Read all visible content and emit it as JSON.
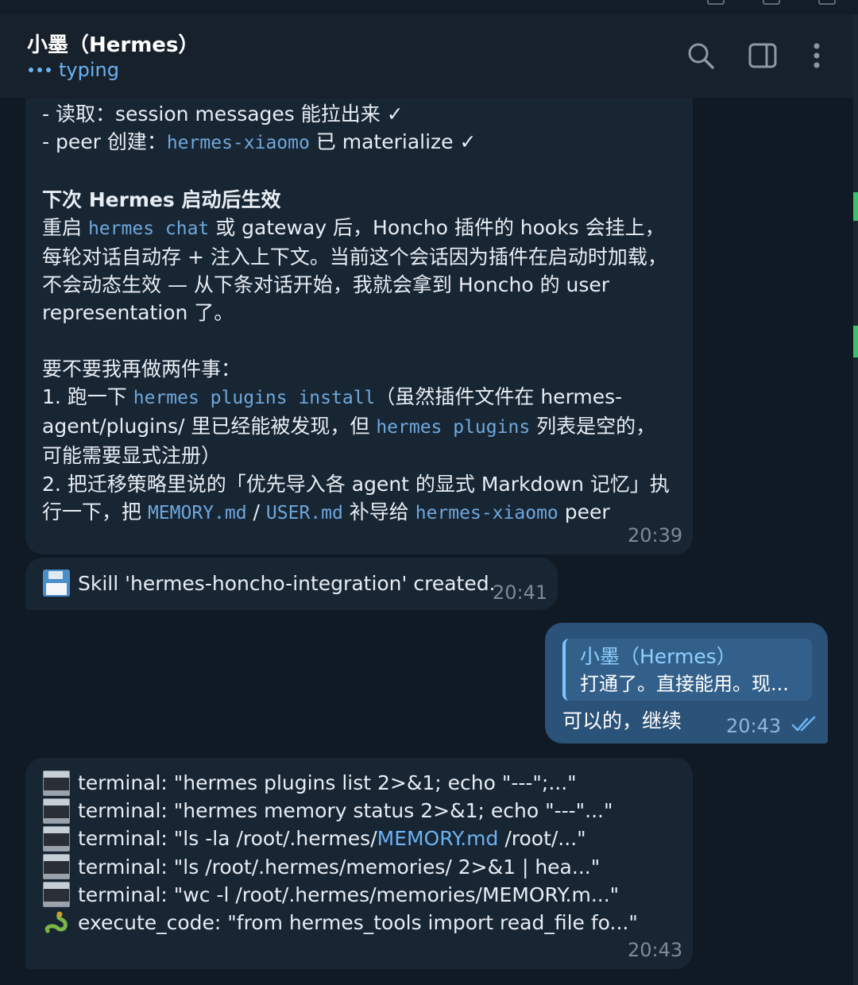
{
  "header": {
    "title": "小墨（Hermes）",
    "status": "typing"
  },
  "message1": {
    "lines": {
      "l1": {
        "a": "- 读取：session messages 能拉出来 ✓"
      },
      "l2": {
        "a": "- peer 创建：",
        "b": "hermes-xiaomo",
        "c": " 已 materialize ✓"
      },
      "heading": "下次 Hermes 启动后生效",
      "l4": {
        "a": "重启 ",
        "b": "hermes chat",
        "c": " 或 gateway 后，Honcho 插件的 hooks 会挂上，"
      },
      "l5": "每轮对话自动存 + 注入上下文。当前这个会话因为插件在启动时加载，",
      "l6": "不会动态生效 — 从下条对话开始，我就会拿到 Honcho 的 user",
      "l7": "representation 了。",
      "l8": "要不要我再做两件事：",
      "l9": {
        "a": "1. 跑一下 ",
        "b": "hermes plugins install",
        "c": "（虽然插件文件在 hermes-"
      },
      "l10": {
        "a": "agent/plugins/ 里已经能被发现，但 ",
        "b": "hermes plugins",
        "c": " 列表是空的，"
      },
      "l11": "可能需要显式注册）",
      "l12": "2. 把迁移策略里说的「优先导入各 agent 的显式 Markdown 记忆」执",
      "l13": {
        "a": "行一下，把 ",
        "b": "MEMORY.md",
        "c": " / ",
        "d": "USER.md",
        "e": " 补导给 ",
        "f": "hermes-xiaomo",
        "g": " peer"
      }
    },
    "time": "20:39"
  },
  "message2": {
    "text": "Skill 'hermes-honcho-integration' created.",
    "time": "20:41"
  },
  "outgoing": {
    "reply_author": "小墨（Hermes）",
    "reply_text": "打通了。直接能用。现...",
    "text": "可以的，继续",
    "time": "20:43"
  },
  "message3": {
    "tools": [
      {
        "a": "terminal: \"hermes plugins list 2>&1; echo \"---\";...\""
      },
      {
        "a": "terminal: \"hermes memory status 2>&1; echo \"---\"...\""
      },
      {
        "a": "terminal: \"ls -la /root/.hermes/",
        "link": "MEMORY.md",
        "b": " /root/...\""
      },
      {
        "a": "terminal: \"ls /root/.hermes/memories/ 2>&1 | hea...\""
      },
      {
        "a": "terminal: \"wc -l /root/.hermes/memories/MEMORY.m...\""
      },
      {
        "a": "execute_code: \"from hermes_tools import read_file fo...\""
      }
    ],
    "time": "20:43"
  },
  "colors": {
    "background": "#0f1a24",
    "incoming_bubble": "#182533",
    "outgoing_bubble": "#2b5278",
    "accent": "#6cb2f2",
    "code": "#6fa8dc"
  }
}
